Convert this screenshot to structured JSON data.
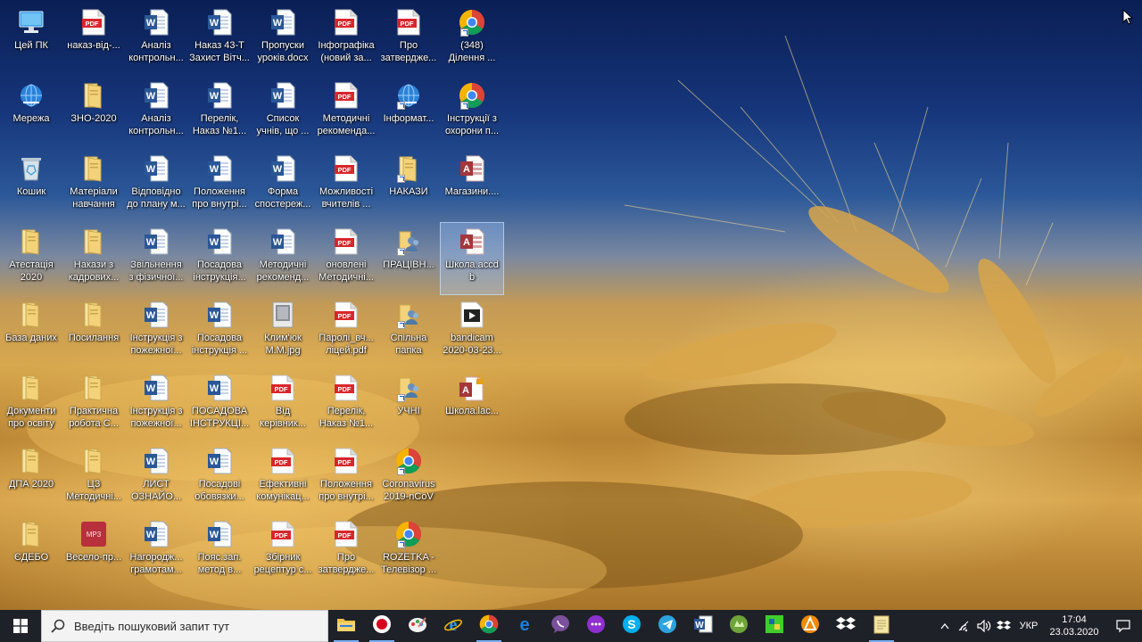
{
  "desktop": {
    "columns": [
      [
        {
          "label": "Цей ПК",
          "icon": "computer-icon",
          "shortcut": false
        },
        {
          "label": "Мережа",
          "icon": "network-icon",
          "shortcut": false
        },
        {
          "label": "Кошик",
          "icon": "recycle-bin-icon",
          "shortcut": false
        },
        {
          "label": "Атестація\n2020",
          "icon": "folder-icon",
          "shortcut": false
        },
        {
          "label": "База даних",
          "icon": "folder-icon",
          "shortcut": false
        },
        {
          "label": "Документи\nпро освіту",
          "icon": "folder-icon",
          "shortcut": false
        },
        {
          "label": "ДПА 2020",
          "icon": "folder-icon",
          "shortcut": false
        },
        {
          "label": "ЄДЕБО",
          "icon": "folder-icon",
          "shortcut": false
        }
      ],
      [
        {
          "label": "наказ-від-...",
          "icon": "pdf-icon",
          "shortcut": false
        },
        {
          "label": "ЗНО-2020",
          "icon": "folder-icon",
          "shortcut": false
        },
        {
          "label": "Матеріали\nнавчання",
          "icon": "folder-icon",
          "shortcut": false
        },
        {
          "label": "Накази з\nкадрових...",
          "icon": "folder-icon",
          "shortcut": false
        },
        {
          "label": "Посилання",
          "icon": "folder-icon",
          "shortcut": false
        },
        {
          "label": "Практична\nробота С...",
          "icon": "folder-icon",
          "shortcut": false
        },
        {
          "label": "ЦЗ\nМетодичні...",
          "icon": "folder-icon",
          "shortcut": false
        },
        {
          "label": "Весело-пр...",
          "icon": "mp3-icon",
          "shortcut": false
        }
      ],
      [
        {
          "label": "Аналіз\nконтрольн...",
          "icon": "word-icon",
          "shortcut": false
        },
        {
          "label": "Аналіз\nконтрольн...",
          "icon": "word-icon",
          "shortcut": false
        },
        {
          "label": "Відповідно\nдо плану м...",
          "icon": "word-icon",
          "shortcut": false
        },
        {
          "label": "Звільнення\nз фізичної...",
          "icon": "word-icon",
          "shortcut": false
        },
        {
          "label": "Інструкція з\nпожежної...",
          "icon": "word-icon",
          "shortcut": false
        },
        {
          "label": "Інструкція з\nпожежної...",
          "icon": "word-icon",
          "shortcut": false
        },
        {
          "label": "ЛИСТ\nОЗНАЙО...",
          "icon": "word-icon",
          "shortcut": false
        },
        {
          "label": "Нагородж...\nграмотам...",
          "icon": "word-icon",
          "shortcut": false
        }
      ],
      [
        {
          "label": "Наказ 43-Т\nЗахист Вітч...",
          "icon": "word-icon",
          "shortcut": false
        },
        {
          "label": "Перелік,\nНаказ №1...",
          "icon": "word-icon",
          "shortcut": false
        },
        {
          "label": "Положення\nпро внутрі...",
          "icon": "word-icon",
          "shortcut": false
        },
        {
          "label": "Посадова\nінструкція...",
          "icon": "word-icon",
          "shortcut": false
        },
        {
          "label": "Посадова\nінструкція ...",
          "icon": "word-icon",
          "shortcut": false
        },
        {
          "label": "ПОСАДОВА\nІНСТРУКЦІ...",
          "icon": "word-icon",
          "shortcut": false
        },
        {
          "label": "Посадові\nобовязки...",
          "icon": "word-icon",
          "shortcut": false
        },
        {
          "label": "Пояс.зап.\nметод в...",
          "icon": "word-icon",
          "shortcut": false
        }
      ],
      [
        {
          "label": "Пропуски\nуроків.docx",
          "icon": "word-icon",
          "shortcut": false
        },
        {
          "label": "Список\nучнів, що ...",
          "icon": "word-icon",
          "shortcut": false
        },
        {
          "label": "Форма\nспостереж...",
          "icon": "word-icon",
          "shortcut": false
        },
        {
          "label": "Методичні\nрекоменд...",
          "icon": "word-icon",
          "shortcut": false
        },
        {
          "label": "Клим'юк\nМ.М.jpg",
          "icon": "image-icon",
          "shortcut": false
        },
        {
          "label": "Від\nкерівник...",
          "icon": "pdf-icon",
          "shortcut": false
        },
        {
          "label": "Ефективні\nкомунікац...",
          "icon": "pdf-icon",
          "shortcut": false
        },
        {
          "label": "Збірник\nрецептур с...",
          "icon": "pdf-icon",
          "shortcut": false
        }
      ],
      [
        {
          "label": "Інфографіка\n(новий за...",
          "icon": "pdf-icon",
          "shortcut": false
        },
        {
          "label": "Методичні\nрекоменда...",
          "icon": "pdf-icon",
          "shortcut": false
        },
        {
          "label": "Можливості\nвчителів ...",
          "icon": "pdf-icon",
          "shortcut": false
        },
        {
          "label": "оновлені\nМетодичні...",
          "icon": "pdf-icon",
          "shortcut": false
        },
        {
          "label": "Паролі_вч...\nліцей.pdf",
          "icon": "pdf-icon",
          "shortcut": false
        },
        {
          "label": "Перелік,\nНаказ №1...",
          "icon": "pdf-icon",
          "shortcut": false
        },
        {
          "label": "Положення\nпро внутрі...",
          "icon": "pdf-icon",
          "shortcut": false
        },
        {
          "label": "Про\nзатвердже...",
          "icon": "pdf-icon",
          "shortcut": false
        }
      ],
      [
        {
          "label": "Про\nзатвердже...",
          "icon": "pdf-icon",
          "shortcut": false
        },
        {
          "label": "Інформат...",
          "icon": "network-icon",
          "shortcut": true
        },
        {
          "label": "НАКАЗИ",
          "icon": "folder-icon",
          "shortcut": true
        },
        {
          "label": "ПРАЦІВН...",
          "icon": "people-folder-icon",
          "shortcut": true
        },
        {
          "label": "Спільна\nпапка",
          "icon": "people-folder-icon",
          "shortcut": true
        },
        {
          "label": "УЧНІ",
          "icon": "people-folder-icon",
          "shortcut": true
        },
        {
          "label": "Coronavirus\n2019-nCoV",
          "icon": "chrome-icon",
          "shortcut": true
        },
        {
          "label": "ROZETKA -\nТелевізор ...",
          "icon": "chrome-icon",
          "shortcut": true
        }
      ],
      [
        {
          "label": "(348)\nДілення ...",
          "icon": "chrome-icon",
          "shortcut": true
        },
        {
          "label": "Інструкції з\nохорони п...",
          "icon": "chrome-icon",
          "shortcut": true
        },
        {
          "label": "Магазини....",
          "icon": "access-icon",
          "shortcut": false
        },
        {
          "label": "Школа.accd\nb",
          "icon": "access-icon",
          "shortcut": false,
          "selected": true
        },
        {
          "label": "bandicam\n2020-03-23...",
          "icon": "video-icon",
          "shortcut": false
        },
        {
          "label": "Школа.lac...",
          "icon": "access-lock-icon",
          "shortcut": false
        }
      ]
    ]
  },
  "taskbar": {
    "search_placeholder": "Введіть пошуковий запит тут",
    "apps": [
      {
        "name": "file-explorer-icon",
        "active": true
      },
      {
        "name": "record-icon",
        "active": true
      },
      {
        "name": "paint-icon",
        "active": false
      },
      {
        "name": "internet-explorer-icon",
        "active": false
      },
      {
        "name": "chrome-icon",
        "active": true
      },
      {
        "name": "edge-icon",
        "active": false
      },
      {
        "name": "viber-icon",
        "active": false
      },
      {
        "name": "dots-app-icon",
        "active": false
      },
      {
        "name": "skype-icon",
        "active": false
      },
      {
        "name": "telegram-icon",
        "active": false
      },
      {
        "name": "word-icon",
        "active": false
      },
      {
        "name": "green-app-icon",
        "active": false
      },
      {
        "name": "game-app-icon",
        "active": false
      },
      {
        "name": "avast-icon",
        "active": false
      },
      {
        "name": "dropbox-icon",
        "active": false
      },
      {
        "name": "notepad-icon",
        "active": true
      }
    ],
    "tray": {
      "language": "УКР",
      "time": "17:04",
      "date": "23.03.2020"
    }
  },
  "colors": {
    "taskbar": "#1f2128",
    "word": "#2b5797",
    "pdf": "#d9262c",
    "folder": "#f3d27a",
    "access": "#a4373a"
  }
}
